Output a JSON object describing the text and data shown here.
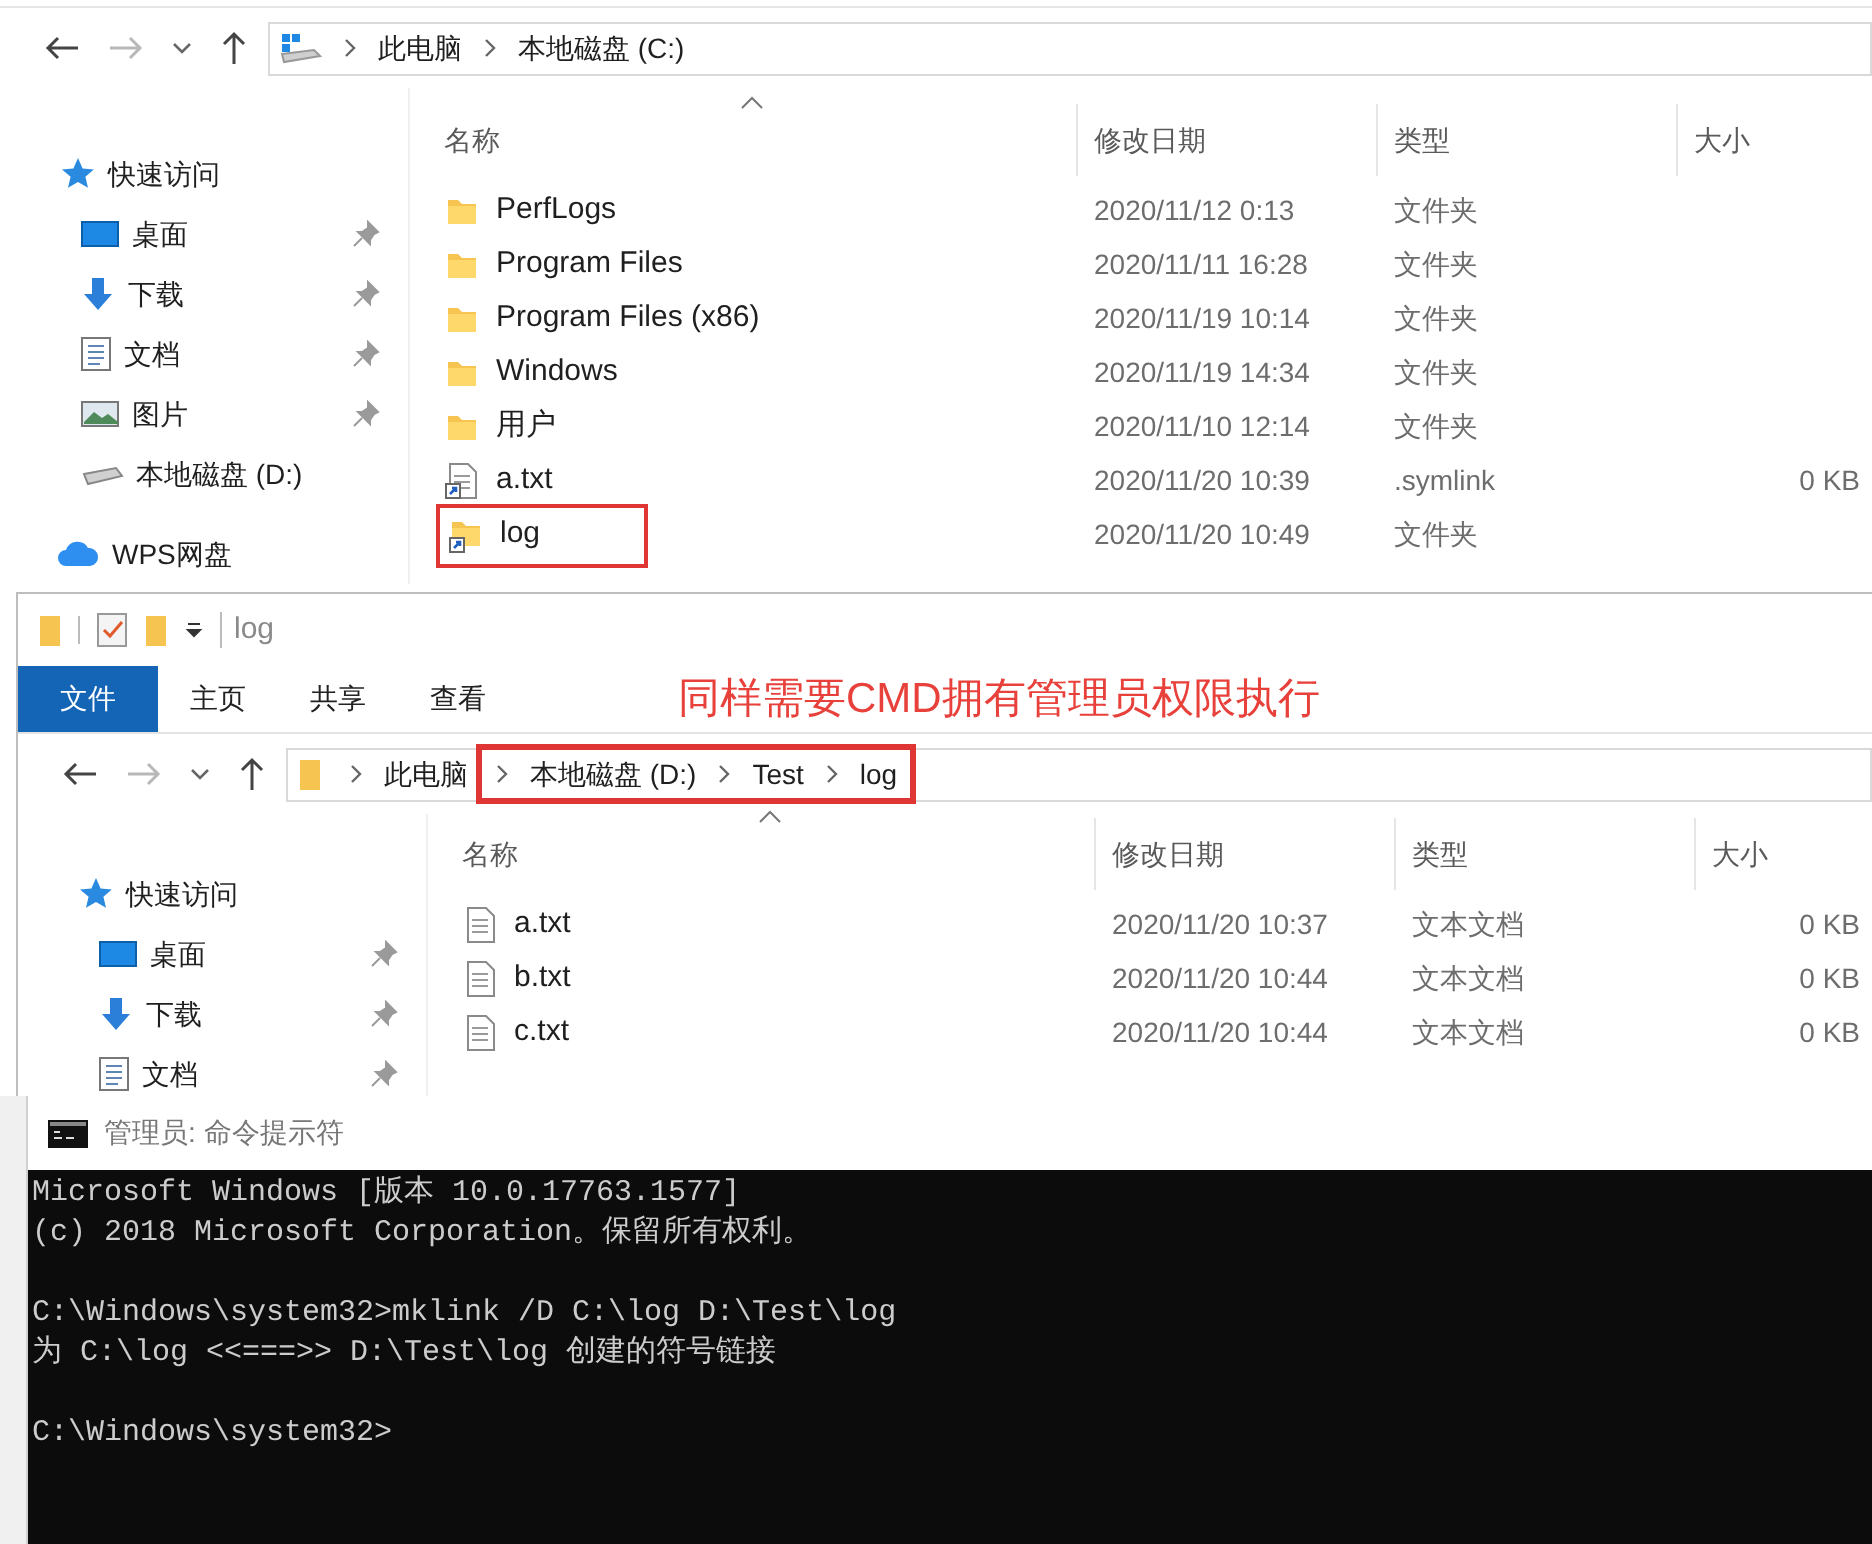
{
  "explorer_c": {
    "address": [
      {
        "label": "此电脑",
        "highlighted": false
      },
      {
        "label": "本地磁盘 (C:)",
        "highlighted": false
      }
    ],
    "address_kind": {
      "kind": "drive"
    },
    "sidebar": [
      {
        "label": "快速访问",
        "kind": "quick",
        "pinned": false
      },
      {
        "label": "桌面",
        "kind": "desktop",
        "pinned": true
      },
      {
        "label": "下载",
        "kind": "download",
        "pinned": true
      },
      {
        "label": "文档",
        "kind": "document",
        "pinned": true
      },
      {
        "label": "图片",
        "kind": "pictures",
        "pinned": true
      },
      {
        "label": "本地磁盘 (D:)",
        "kind": "drive",
        "pinned": false
      },
      {
        "label": "WPS网盘",
        "kind": "cloud",
        "pinned": false
      }
    ],
    "columns": [
      "名称",
      "修改日期",
      "类型",
      "大小"
    ],
    "rows": [
      {
        "name": "PerfLogs",
        "kind": "folder",
        "modified": "2020/11/12 0:13",
        "type": "文件夹",
        "highlighted": false
      },
      {
        "name": "Program Files",
        "kind": "folder",
        "modified": "2020/11/11 16:28",
        "type": "文件夹",
        "highlighted": false
      },
      {
        "name": "Program Files (x86)",
        "kind": "folder",
        "modified": "2020/11/19 10:14",
        "type": "文件夹",
        "highlighted": false
      },
      {
        "name": "Windows",
        "kind": "folder",
        "modified": "2020/11/19 14:34",
        "type": "文件夹",
        "highlighted": false
      },
      {
        "name": "用户",
        "kind": "folder",
        "modified": "2020/11/10 12:14",
        "type": "文件夹",
        "highlighted": false
      },
      {
        "name": "a.txt",
        "kind": "file-link",
        "modified": "2020/11/20 10:39",
        "type": ".symlink",
        "size": "0 KB",
        "highlighted": false
      },
      {
        "name": "log",
        "kind": "folder-link",
        "modified": "2020/11/20 10:49",
        "type": "文件夹",
        "highlighted": true
      }
    ]
  },
  "explorer_log": {
    "title": "log",
    "ribbon_tabs": [
      {
        "label": "文件",
        "selected": true
      },
      {
        "label": "主页",
        "selected": false
      },
      {
        "label": "共享",
        "selected": false
      },
      {
        "label": "查看",
        "selected": false
      }
    ],
    "annotation": "同样需要CMD拥有管理员权限执行",
    "address_kind": {
      "kind": "folder"
    },
    "address": [
      {
        "label": "此电脑",
        "highlighted": false
      },
      {
        "label": "本地磁盘 (D:)",
        "highlighted": true
      },
      {
        "label": "Test",
        "highlighted": true
      },
      {
        "label": "log",
        "highlighted": true
      }
    ],
    "sidebar": [
      {
        "label": "快速访问",
        "kind": "quick",
        "pinned": false
      },
      {
        "label": "桌面",
        "kind": "desktop",
        "pinned": true
      },
      {
        "label": "下载",
        "kind": "download",
        "pinned": true
      },
      {
        "label": "文档",
        "kind": "document",
        "pinned": true
      }
    ],
    "columns": [
      "名称",
      "修改日期",
      "类型",
      "大小"
    ],
    "rows": [
      {
        "name": "a.txt",
        "kind": "file",
        "modified": "2020/11/20 10:37",
        "type": "文本文档",
        "size": "0 KB",
        "highlighted": false
      },
      {
        "name": "b.txt",
        "kind": "file",
        "modified": "2020/11/20 10:44",
        "type": "文本文档",
        "size": "0 KB",
        "highlighted": false
      },
      {
        "name": "c.txt",
        "kind": "file",
        "modified": "2020/11/20 10:44",
        "type": "文本文档",
        "size": "0 KB",
        "highlighted": false
      }
    ]
  },
  "cmd": {
    "title": "管理员: 命令提示符",
    "blocks": [
      [
        "Microsoft Windows [版本 10.0.17763.1577]",
        "(c) 2018 Microsoft Corporation。保留所有权利。"
      ],
      [
        "C:\\Windows\\system32>mklink /D C:\\log D:\\Test\\log",
        "为 C:\\log <<===>> D:\\Test\\log 创建的符号链接"
      ],
      [
        "C:\\Windows\\system32>"
      ]
    ]
  }
}
